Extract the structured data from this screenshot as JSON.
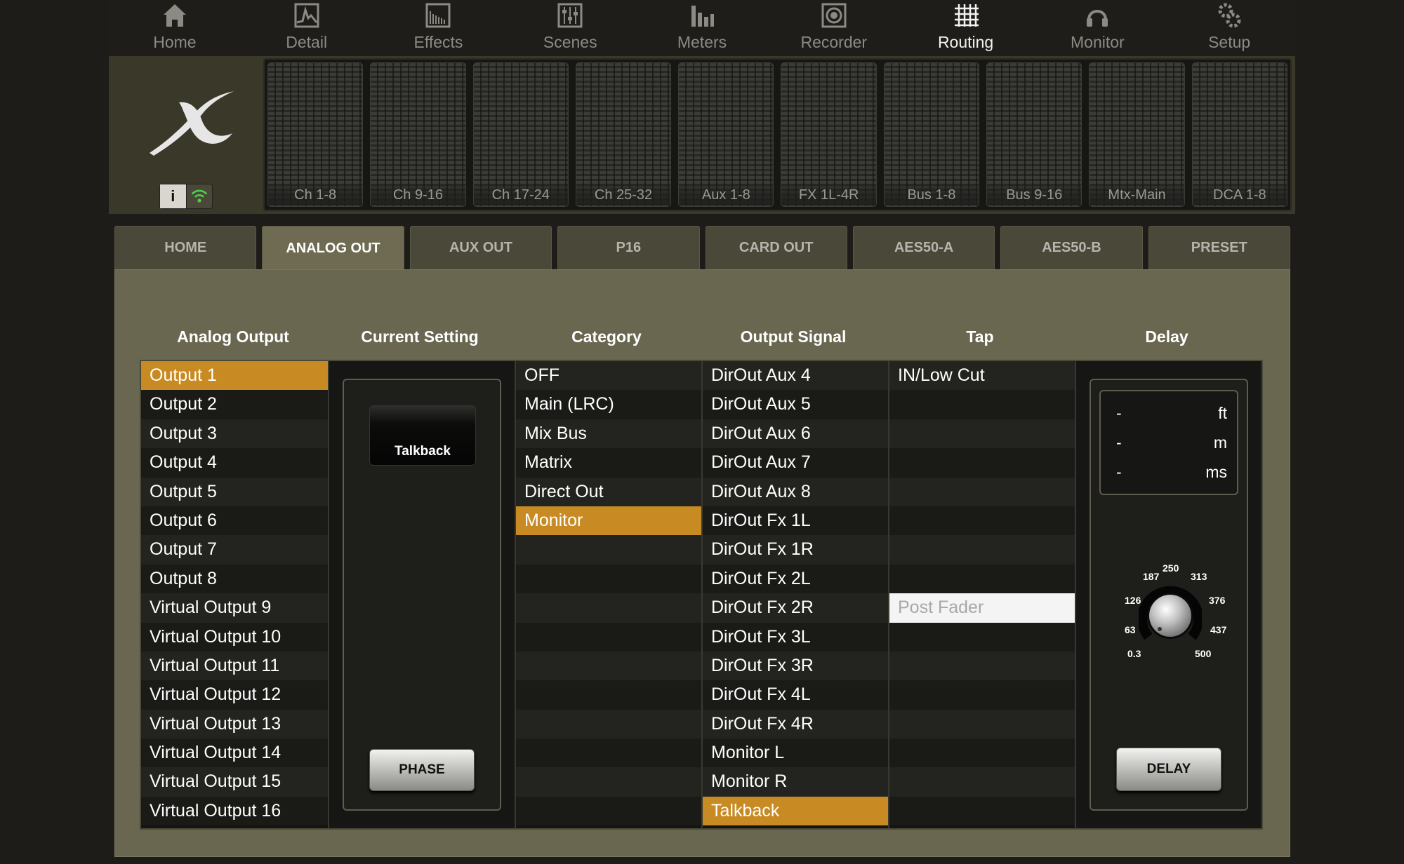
{
  "nav": [
    {
      "label": "Home",
      "icon": "house-icon",
      "active": false
    },
    {
      "label": "Detail",
      "icon": "waveform-icon",
      "active": false
    },
    {
      "label": "Effects",
      "icon": "effects-icon",
      "active": false
    },
    {
      "label": "Scenes",
      "icon": "sliders-icon",
      "active": false
    },
    {
      "label": "Meters",
      "icon": "meters-icon",
      "active": false
    },
    {
      "label": "Recorder",
      "icon": "record-icon",
      "active": false
    },
    {
      "label": "Routing",
      "icon": "routing-grid-icon",
      "active": true
    },
    {
      "label": "Monitor",
      "icon": "headphones-icon",
      "active": false
    },
    {
      "label": "Setup",
      "icon": "gears-icon",
      "active": false
    }
  ],
  "strips": [
    "Ch 1-8",
    "Ch 9-16",
    "Ch 17-24",
    "Ch 25-32",
    "Aux 1-8",
    "FX 1L-4R",
    "Bus 1-8",
    "Bus 9-16",
    "Mtx-Main",
    "DCA 1-8"
  ],
  "tabs": [
    {
      "label": "HOME",
      "active": false
    },
    {
      "label": "ANALOG OUT",
      "active": true
    },
    {
      "label": "AUX OUT",
      "active": false
    },
    {
      "label": "P16",
      "active": false
    },
    {
      "label": "CARD OUT",
      "active": false
    },
    {
      "label": "AES50-A",
      "active": false
    },
    {
      "label": "AES50-B",
      "active": false
    },
    {
      "label": "PRESET",
      "active": false
    }
  ],
  "headers": {
    "analog_output": "Analog Output",
    "current_setting": "Current Setting",
    "category": "Category",
    "output_signal": "Output Signal",
    "tap": "Tap",
    "delay": "Delay"
  },
  "analog_outputs": [
    "Output 1",
    "Output 2",
    "Output 3",
    "Output 4",
    "Output 5",
    "Output 6",
    "Output 7",
    "Output 8",
    "Virtual Output 9",
    "Virtual Output 10",
    "Virtual Output 11",
    "Virtual Output 12",
    "Virtual Output 13",
    "Virtual Output 14",
    "Virtual Output 15",
    "Virtual Output 16"
  ],
  "analog_output_selected": 0,
  "current_setting": {
    "value": "Talkback",
    "phase_label": "PHASE"
  },
  "categories": [
    "OFF",
    "Main (LRC)",
    "Mix Bus",
    "Matrix",
    "Direct Out",
    "Monitor"
  ],
  "category_selected": 5,
  "output_signals": [
    "DirOut Aux 4",
    "DirOut Aux 5",
    "DirOut Aux 6",
    "DirOut Aux 7",
    "DirOut Aux 8",
    "DirOut Fx 1L",
    "DirOut Fx 1R",
    "DirOut Fx 2L",
    "DirOut Fx 2R",
    "DirOut Fx 3L",
    "DirOut Fx 3R",
    "DirOut Fx 4L",
    "DirOut Fx 4R",
    "Monitor L",
    "Monitor R",
    "Talkback"
  ],
  "output_signal_selected": 15,
  "tap": {
    "first": "IN/Low Cut",
    "selected_label": "Post Fader",
    "selected_index": 8
  },
  "delay": {
    "readout": [
      {
        "value": "-",
        "unit": "ft"
      },
      {
        "value": "-",
        "unit": "m"
      },
      {
        "value": "-",
        "unit": "ms"
      }
    ],
    "scale": [
      "0.3",
      "63",
      "126",
      "187",
      "250",
      "313",
      "376",
      "437",
      "500"
    ],
    "button_label": "DELAY"
  },
  "colors": {
    "selected": "#c88a22",
    "panel": "#6a6750",
    "active_tab": "#6e6b52"
  }
}
